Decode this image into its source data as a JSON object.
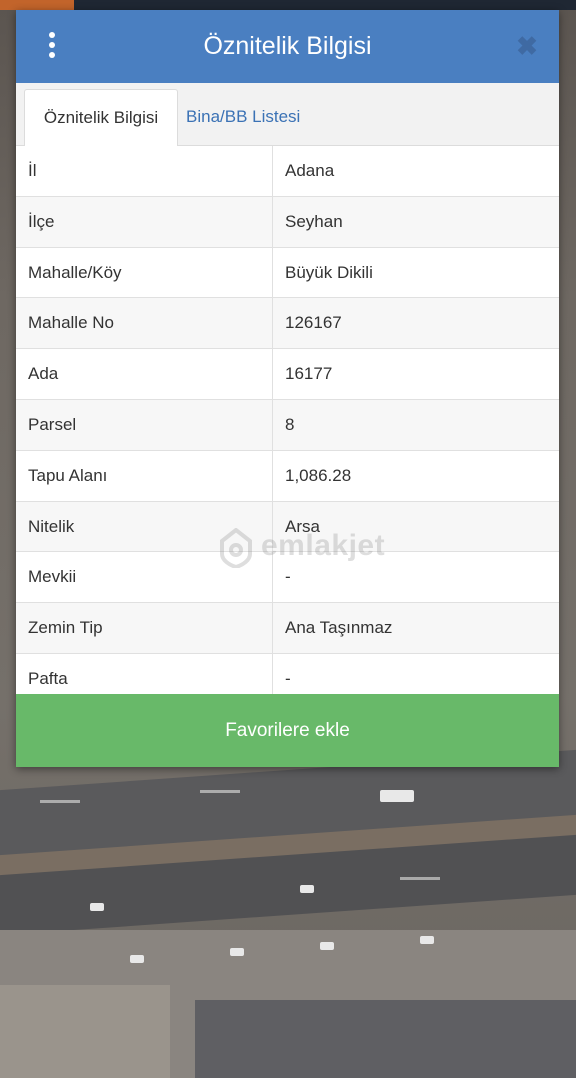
{
  "dialog": {
    "title": "Öznitelik Bilgisi",
    "close_symbol": "✖",
    "tabs": [
      {
        "label": "Öznitelik Bilgisi",
        "active": true
      },
      {
        "label": "Bina/BB Listesi",
        "active": false
      }
    ],
    "rows": [
      {
        "key": "İl",
        "value": "Adana"
      },
      {
        "key": "İlçe",
        "value": "Seyhan"
      },
      {
        "key": "Mahalle/Köy",
        "value": "Büyük Dikili"
      },
      {
        "key": "Mahalle No",
        "value": "126167"
      },
      {
        "key": "Ada",
        "value": "16177"
      },
      {
        "key": "Parsel",
        "value": "8"
      },
      {
        "key": "Tapu Alanı",
        "value": "1,086.28"
      },
      {
        "key": "Nitelik",
        "value": "Arsa"
      },
      {
        "key": "Mevkii",
        "value": "-"
      },
      {
        "key": "Zemin Tip",
        "value": "Ana Taşınmaz"
      },
      {
        "key": "Pafta",
        "value": "-"
      }
    ],
    "favorite_button": "Favorilere ekle"
  },
  "watermark": {
    "text": "emlakjet"
  },
  "colors": {
    "header": "#4a7fc1",
    "tab_link": "#3b72b5",
    "favorite_button": "#68b969"
  },
  "icons": {
    "menu": "kebab-menu-icon",
    "close": "close-icon",
    "watermark": "home-pin-icon"
  }
}
